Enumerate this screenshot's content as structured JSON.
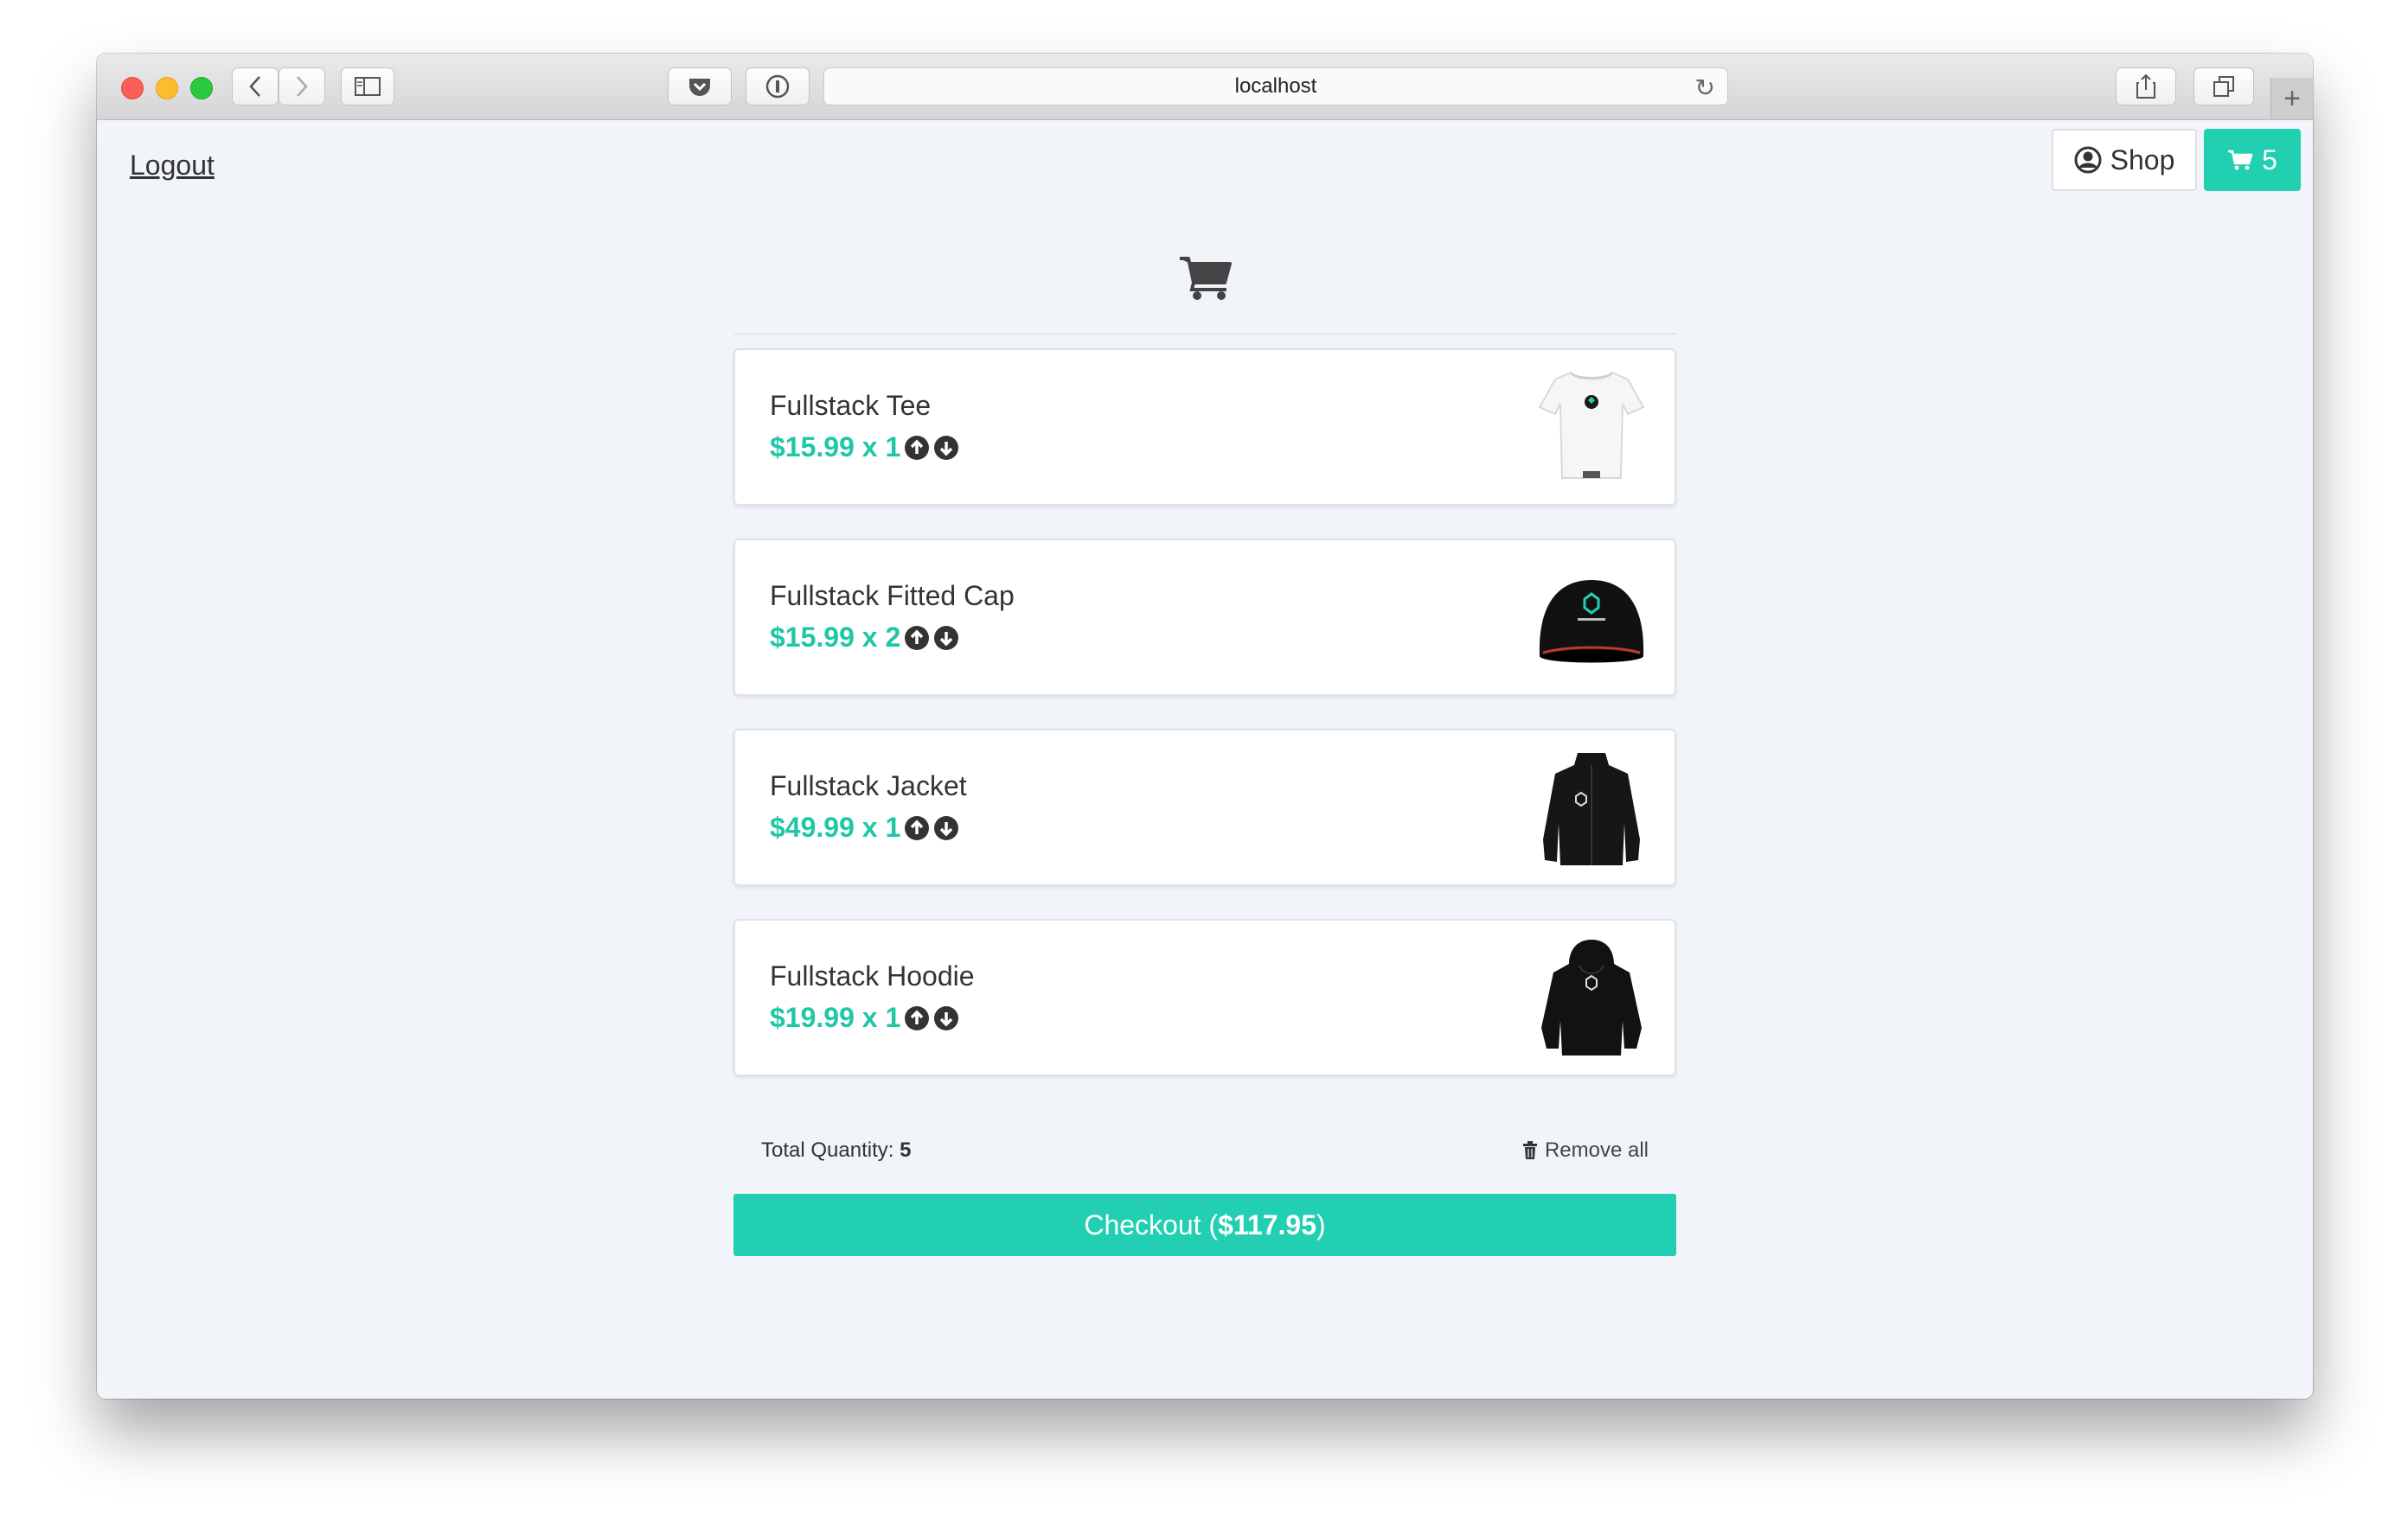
{
  "browser": {
    "url": "localhost",
    "icons": [
      "back-icon",
      "forward-icon",
      "sidebar-icon",
      "pocket-icon",
      "password-icon",
      "reload-icon",
      "share-icon",
      "tabs-icon",
      "new-tab-icon"
    ]
  },
  "header": {
    "logout_label": "Logout",
    "shop_label": "Shop",
    "cart_count": "5"
  },
  "cart": {
    "items": [
      {
        "name": "Fullstack Tee",
        "price_qty": "$15.99 x 1",
        "image": "white-tee"
      },
      {
        "name": "Fullstack Fitted Cap",
        "price_qty": "$15.99 x 2",
        "image": "black-cap"
      },
      {
        "name": "Fullstack Jacket",
        "price_qty": "$49.99 x 1",
        "image": "black-jacket"
      },
      {
        "name": "Fullstack Hoodie",
        "price_qty": "$19.99 x 1",
        "image": "black-hoodie"
      }
    ],
    "total_quantity_label": "Total Quantity:",
    "total_quantity": "5",
    "remove_all_label": "Remove all",
    "checkout_label": "Checkout",
    "checkout_total": "$117.95"
  },
  "colors": {
    "accent": "#20d0b0",
    "price": "#20c7a7",
    "page_bg": "#f1f4f8"
  }
}
